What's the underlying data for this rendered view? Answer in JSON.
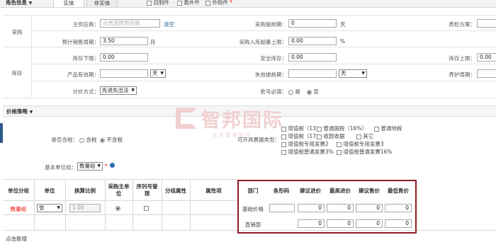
{
  "tabs": {
    "section": "角色信息",
    "entity": "实体",
    "non_entity": "非实体",
    "self_made": "自制件",
    "purchased_part": "委外件",
    "outsourced": "外购件",
    "required_mark": "*"
  },
  "purchase": {
    "label": "采购",
    "main_supplier_label": "主供应商：",
    "main_supplier_placeholder": "点击选择供应商",
    "clear": "清空",
    "lead_time_label": "采购提前期：",
    "lead_time_value": "0",
    "lead_time_unit": "天",
    "qc_plan_label": "质检方案：",
    "forecast_label": "预计销售周期：",
    "forecast_value": "3.50",
    "forecast_unit": "月",
    "excess_label": "采购入库超量上限：",
    "excess_value": "0.00",
    "excess_unit": "%"
  },
  "inventory": {
    "label": "库存",
    "min_label": "库存下限：",
    "min_value": "0.00",
    "safety_label": "安全库存：",
    "safety_value": "0.00",
    "max_label": "库存上限：",
    "max_value": "0.00",
    "shelf_label": "产品有效期：",
    "shelf_unit": "天",
    "expire_label": "失效提前期：",
    "expire_unit": "天",
    "maint_label": "养护周期：",
    "cost_label": "计价方式：",
    "cost_value": "先进先出法",
    "batch_label": "批号必填：",
    "batch_yes": "是",
    "batch_no": "否"
  },
  "pricing": {
    "section": "价格策略",
    "tax_label": "是否含税：",
    "tax_yes": "含税",
    "tax_no": "不含税",
    "invoice_label": "可开具票据类型：",
    "invoice_options": [
      "增值税（13）",
      "普通国税（16%）",
      "普通地税",
      "增值税（17）",
      "收款收据",
      "其它",
      "增值税专用发票2",
      "增值税专用发票3",
      "增值税普通发票3%",
      "增值税普通发票16%"
    ],
    "base_unit_label": "基本单位组：",
    "base_unit_value": "数量组"
  },
  "watermark": {
    "text": "智邦国际",
    "sub": "企 业 管 理 软 件"
  },
  "unit_table": {
    "headers": [
      "单位分组",
      "单位",
      "换算比例",
      "采购主单位",
      "序列号管理",
      "分组属性",
      "属性项"
    ],
    "group": "数量组",
    "unit": "张",
    "ratio": "1.00",
    "add_new": "点击新增"
  },
  "price_table": {
    "headers": [
      "部门",
      "条形码",
      "建议进价",
      "最高进价",
      "建议售价",
      "最低售价"
    ],
    "rows": [
      {
        "dept": "基础价格",
        "barcode": "",
        "v1": "0",
        "v2": "0",
        "v3": "0",
        "v4": "0"
      },
      {
        "dept": "直销部",
        "v1": "0",
        "v2": "0",
        "v3": "0",
        "v4": "0"
      }
    ]
  }
}
